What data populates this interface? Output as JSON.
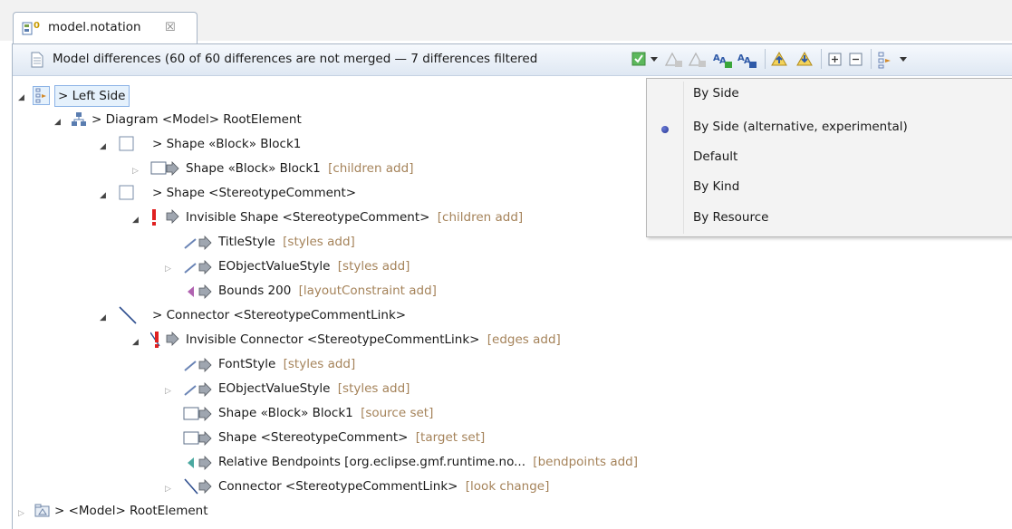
{
  "tab": {
    "title": "model.notation",
    "close_glyph": "☒"
  },
  "toolbar": {
    "title": "Model differences  (60 of 60 differences are not merged — 7 differences filtered",
    "buttons": [
      "filter-checkbox",
      "filter-dropdown",
      "accept-change",
      "reject-change",
      "accept-all",
      "reject-all",
      "previous-difference",
      "next-difference",
      "expand-all",
      "collapse-all",
      "group-by",
      "group-by-dropdown"
    ]
  },
  "tree": {
    "left_side": {
      "label": "> Left Side"
    },
    "diagram": {
      "label": "> Diagram <Model> RootElement"
    },
    "shape_block": {
      "label": "> Shape «Block» Block1"
    },
    "shape_block_child": {
      "label": "Shape «Block» Block1",
      "hint": "[children add]"
    },
    "shape_stereo": {
      "label": "> Shape <StereotypeComment>"
    },
    "invisible_shape": {
      "label": "Invisible Shape <StereotypeComment>",
      "hint": "[children add]"
    },
    "title_style": {
      "label": "TitleStyle",
      "hint": "[styles add]"
    },
    "eobject_style_1": {
      "label": "EObjectValueStyle",
      "hint": "[styles add]"
    },
    "bounds": {
      "label": "Bounds 200",
      "hint": "[layoutConstraint add]"
    },
    "connector": {
      "label": "> Connector <StereotypeCommentLink>"
    },
    "invisible_connector": {
      "label": "Invisible Connector <StereotypeCommentLink>",
      "hint": "[edges add]"
    },
    "font_style": {
      "label": "FontStyle",
      "hint": "[styles add]"
    },
    "eobject_style_2": {
      "label": "EObjectValueStyle",
      "hint": "[styles add]"
    },
    "shape_source": {
      "label": "Shape «Block» Block1",
      "hint": "[source set]"
    },
    "shape_target": {
      "label": "Shape <StereotypeComment>",
      "hint": "[target set]"
    },
    "bendpoints": {
      "label": "Relative Bendpoints [org.eclipse.gmf.runtime.no...",
      "hint": "[bendpoints add]"
    },
    "connector_look": {
      "label": "Connector <StereotypeCommentLink>",
      "hint": "[look change]"
    },
    "model_root": {
      "label": "> <Model> RootElement"
    }
  },
  "menu": {
    "items": [
      "By Side",
      "By Side (alternative, experimental)",
      "Default",
      "By Kind",
      "By Resource"
    ],
    "checked": "By Side (alternative, experimental)",
    "highlighted": "Default"
  },
  "colors": {
    "hint": "#a5835a",
    "conflict": "#e02020",
    "toolbar_top": "#f6f9fd",
    "toolbar_bottom": "#dfe8f3"
  }
}
